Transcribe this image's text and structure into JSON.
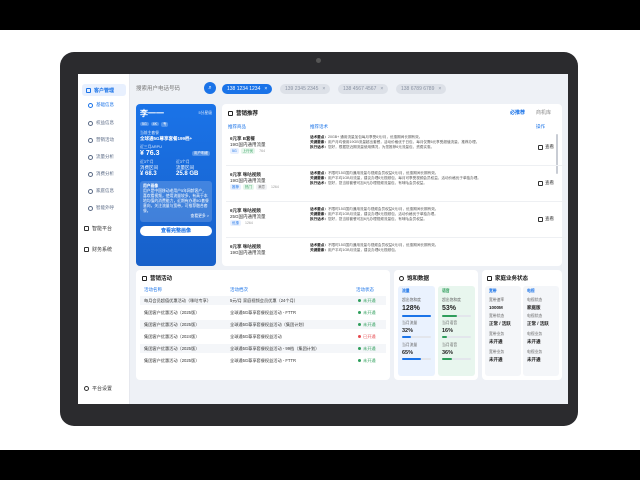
{
  "sidebar": {
    "main": "客户管理",
    "items": [
      {
        "label": "基础信息",
        "active": true
      },
      {
        "label": "权益信息",
        "active": false
      },
      {
        "label": "营销活动",
        "active": false
      },
      {
        "label": "流量分析",
        "active": false
      },
      {
        "label": "消费分析",
        "active": false
      },
      {
        "label": "家庭信息",
        "active": false
      },
      {
        "label": "智能外呼",
        "active": false
      }
    ],
    "groups": [
      "智能平台",
      "财务系统"
    ],
    "settings": "平台设置"
  },
  "search": {
    "placeholder": "搜索用户电话号码"
  },
  "phones": [
    {
      "number": "138 1234 1234",
      "active": true
    },
    {
      "number": "139 2345 2345",
      "active": false
    },
    {
      "number": "138 4567 4567",
      "active": false
    },
    {
      "number": "138 6789 6789",
      "active": false
    }
  ],
  "customer": {
    "name": "李一一",
    "score_label": "5分星级",
    "tags": [
      "5G",
      "4K",
      "专"
    ],
    "pkg_label": "当前主套餐",
    "pkg": "全球通5G尊享套餐199档+",
    "arpu_label": "近三月ARPU",
    "arpu": "¥ 76.3",
    "arpu_btn": "用户明细",
    "flow1_label": "近3个月",
    "flow1": "消费区间",
    "flow2_label": "近3个月",
    "flow2": "流量区间",
    "v1": "¥ 68.3",
    "v2": "25.8 GB",
    "portrait_title": "用户画像",
    "portrait": "用户是中国移动老用户5年网龄客户，喜欢看视频，使用流量较多，有高于本地均值的消费能力，近期有办理5G套餐意向，关注流量与宽带，可推荐融合套餐。",
    "portrait_more": "查看更多 >",
    "btn": "查看完整画像"
  },
  "suggest": {
    "title": "营销推荐",
    "tab_active": "必推荐",
    "tab2": "商机库",
    "col1": "推荐商品",
    "col2": "推荐话术",
    "col3": "操作",
    "rows": [
      {
        "prod1": "6元享 B套餐",
        "prod2": "19G国内通用流量",
        "tags": [
          "5G",
          "上行优"
        ],
        "score": "764",
        "d1": "话术要点：",
        "t1": "20GB+ 通用流量加包每月享受6元/月，优惠期间长期有效。",
        "d2": "关键要素：",
        "t2": "用户月均使用19GB流量超出套餐，活动价格优于日包，每月仅需6元享受超值流量，推荐办理。",
        "d3": "执行话术：",
        "t3": "您好，根据您近期流量使用情况，为您推荐6元流量包，资费实惠。"
      },
      {
        "prod1": "6元享 咪咕视频",
        "prod2": "19G国内通用流量",
        "tags": [
          "推荐",
          "热门",
          "满意"
        ],
        "score": "1264",
        "d1": "话术要点：",
        "t1": "不限时15G国内通用流量与视频会员权益6元/月，优惠期间长期有效。",
        "d2": "关键要素：",
        "t2": "用户平均1GB月流量，建议办理6元视频包，每月可享受视频会员权益，活动价格优于单独办理。",
        "d3": "执行话术：",
        "t3": "您好，您当前套餐可加6元办理视频流量包，有咪咕会员权益。"
      },
      {
        "prod1": "6元享 咪咕视频",
        "prod2": "25G国内通用流量",
        "tags": [
          "优惠"
        ],
        "score": "1264",
        "d1": "话术要点：",
        "t1": "不限时15G国内通用流量与视频会员权益6元/月，优惠期间长期有效。",
        "d2": "关键要素：",
        "t2": "用户平均1GB月流量，建议办理6元视频包，活动价格优于单独办理。",
        "d3": "执行话术：",
        "t3": "您好，您当前套餐可加6元办理视频流量包，有咪咕会员权益。"
      },
      {
        "prod1": "6元享 咪咕视频",
        "prod2": "19G国内通用流量",
        "tags": [],
        "score": "",
        "d1": "话术要点：",
        "t1": "不限时15G国内通用流量与视频会员权益6元/月，优惠期间长期有效。",
        "d2": "关键要素：",
        "t2": "用户平均1GB月流量，建议办理6元视频包。",
        "d3": "执行话术：",
        "t3": ""
      }
    ],
    "action": "查看"
  },
  "activities": {
    "title": "营销活动",
    "col1": "活动名称",
    "col2": "活动档次",
    "col3": "活动状态",
    "rows": [
      {
        "name": "每月会员超值优惠活动（咪咕专享）",
        "level": "5元/月 家庭视频会员优惠（24个月）",
        "status": "未开通",
        "color": "#2e9e5b"
      },
      {
        "name": "集团客户优惠活动（2025版）",
        "level": "全球通5G尊享套餐权益活动 - FTTR",
        "status": "未开通",
        "color": "#2e9e5b"
      },
      {
        "name": "集团客户优惠活动（2025版）",
        "level": "全球通5G尊享套餐权益活动（集团计划）",
        "status": "未开通",
        "color": "#2e9e5b"
      },
      {
        "name": "集团客户优惠活动（2024版）",
        "level": "全球通5G尊享套餐权益活动",
        "status": "已开通",
        "color": "#e5484d"
      },
      {
        "name": "集团客户优惠活动（2025版）",
        "level": "全球通5G尊享套餐权益活动 - 99档（集团计划）",
        "status": "未开通",
        "color": "#2e9e5b"
      },
      {
        "name": "集团客户优惠活动（2025版）",
        "level": "全球通5G尊享套餐权益活动 - FTTR",
        "status": "未开通",
        "color": "#2e9e5b"
      }
    ]
  },
  "usage": {
    "title": "饱和数据",
    "flow_label": "流量",
    "voice_label": "语音",
    "f_sat_label": "超出饱和度",
    "f_sat": "128%",
    "v_sat_label": "超出饱和度",
    "v_sat": "53%",
    "f_m1_label": "当月流量",
    "f_m1": "32%",
    "v_m1_label": "当月语音",
    "v_m1": "16%",
    "f_m2_label": "当月流量",
    "f_m2": "65%",
    "v_m2_label": "当月语音",
    "v_m2": "36%",
    "f_sat_fill": 1.0,
    "v_sat_fill": 0.53,
    "f_m1_fill": 0.32,
    "v_m1_fill": 0.16,
    "f_m2_fill": 0.65,
    "v_m2_fill": 0.36
  },
  "family": {
    "title": "家庭业务状态",
    "bb_label": "宽带",
    "tv_label": "电视",
    "bb_speed_label": "宽带速率",
    "bb_speed": "1000M",
    "tv_state_label": "电视状态",
    "tv_state": "家庭版",
    "bb_status_label": "宽带状态",
    "bb_status": "正常 / 活跃",
    "tv_status_label": "电视状态",
    "tv_status": "正常 / 活跃",
    "bb_a_label": "宽带业务",
    "bb_a": "未开通",
    "tv_a_label": "电视业务",
    "tv_a": "未开通",
    "bb_b_label": "宽带业务",
    "bb_b": "未开通",
    "tv_b_label": "电视业务",
    "tv_b": "未开通"
  }
}
